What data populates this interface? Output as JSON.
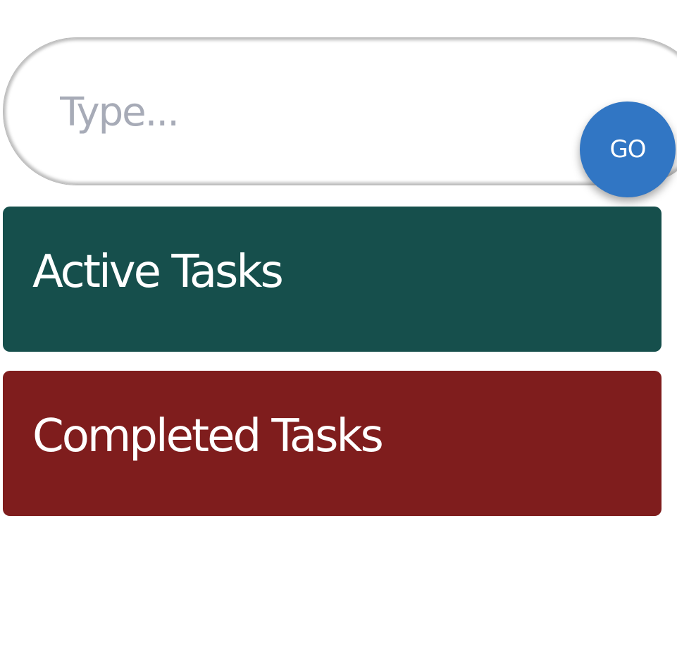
{
  "search": {
    "placeholder": "Type...",
    "value": "",
    "go_label": "GO",
    "go_color": "#3176c4"
  },
  "sections": [
    {
      "title": "Active Tasks",
      "color": "#164f4c"
    },
    {
      "title": "Completed Tasks",
      "color": "#7f1d1d"
    }
  ]
}
